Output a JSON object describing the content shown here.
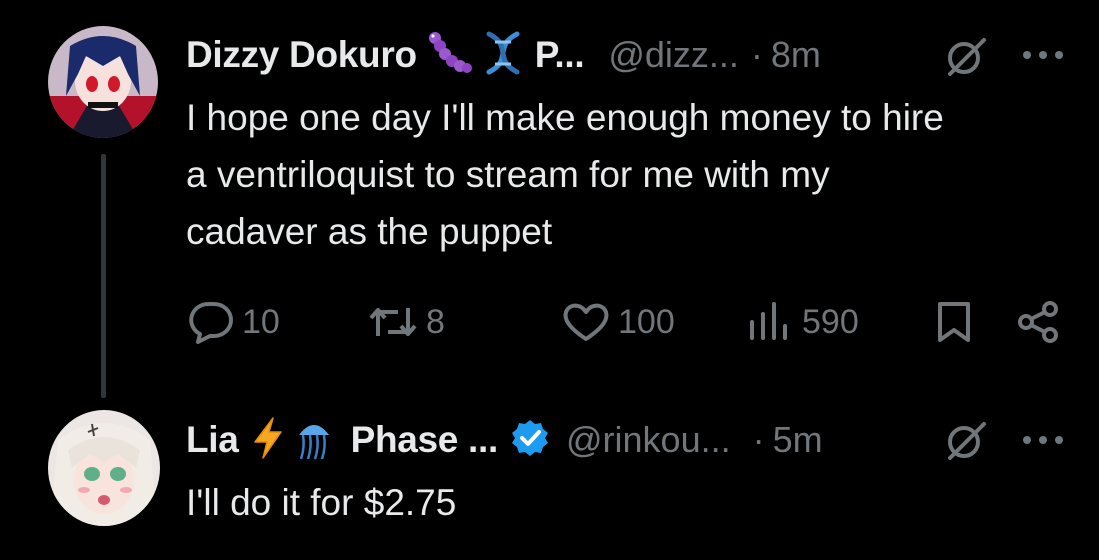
{
  "tweets": [
    {
      "author": {
        "name": "Dizzy Dokuro",
        "name_suffix": "P...",
        "handle": "@dizz...",
        "emojis": [
          "purple-caterpillar-icon",
          "dna-icon"
        ]
      },
      "dot": "·",
      "time": "8m",
      "text_lines": [
        "I hope one day I'll make enough money to hire",
        "a ventriloquist to stream for me with my",
        "cadaver as the puppet"
      ],
      "actions": {
        "replies": "10",
        "retweets": "8",
        "likes": "100",
        "views": "590"
      }
    },
    {
      "author": {
        "name": "Lia",
        "name_suffix": "Phase ...",
        "handle": "@rinkou...",
        "emojis": [
          "lightning-icon",
          "jellyfish-icon"
        ],
        "verified": true
      },
      "dot": "·",
      "time": "5m",
      "text_lines": [
        "I'll do it for $2.75"
      ]
    }
  ],
  "colors": {
    "background": "#000000",
    "text": "#e7e9ea",
    "muted": "#71767b",
    "thread_line": "#333639",
    "verified_blue": "#1d9bf0"
  }
}
